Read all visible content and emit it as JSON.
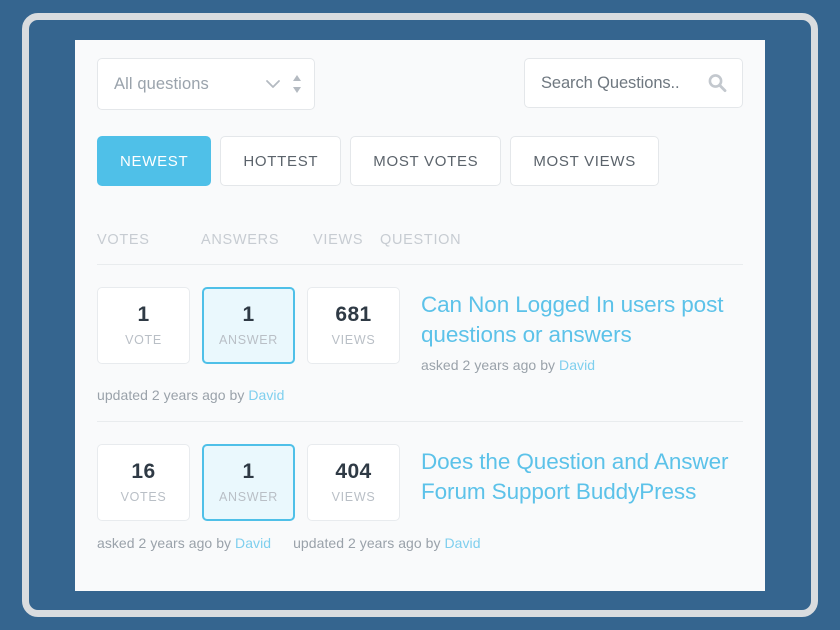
{
  "filter": {
    "selected": "All questions",
    "chevron_icon": "chevron-down-icon",
    "spinner_icon": "sort-spinner-icon"
  },
  "search": {
    "placeholder": "Search Questions..",
    "value": "",
    "icon": "search-icon"
  },
  "tabs": [
    {
      "label": "NEWEST",
      "active": true
    },
    {
      "label": "HOTTEST",
      "active": false
    },
    {
      "label": "MOST VOTES",
      "active": false
    },
    {
      "label": "MOST VIEWS",
      "active": false
    }
  ],
  "columns": {
    "votes": "VOTES",
    "answers": "ANSWERS",
    "views": "VIEWS",
    "question": "QUESTION"
  },
  "questions": [
    {
      "votes_value": "1",
      "votes_label": "VOTE",
      "answers_value": "1",
      "answers_label": "ANSWER",
      "answers_highlight": true,
      "views_value": "681",
      "views_label": "VIEWS",
      "title": "Can Non Logged In users post questions or answers",
      "asked_prefix": "asked 2 years ago by",
      "asked_author": "David",
      "updated_prefix": "updated 2 years ago by",
      "updated_author": "David",
      "foot_show_asked": false,
      "foot_show_updated": true
    },
    {
      "votes_value": "16",
      "votes_label": "VOTES",
      "answers_value": "1",
      "answers_label": "ANSWER",
      "answers_highlight": true,
      "views_value": "404",
      "views_label": "VIEWS",
      "title": "Does the Question and Answer Forum Support BuddyPress",
      "asked_prefix": "asked 2 years ago by",
      "asked_author": "David",
      "updated_prefix": "updated 2 years ago by",
      "updated_author": "David",
      "foot_show_asked": true,
      "foot_show_updated": true
    }
  ],
  "colors": {
    "page_background": "#35658f",
    "frame_border": "#d9dcdf",
    "panel_background": "#f9fafb",
    "accent_blue": "#4fc0e8",
    "link_blue": "#5cc2e9",
    "author_blue": "#7fcfee",
    "stat_number": "#2f3a45",
    "muted_text": "#9aa2aa",
    "header_text": "#c7ccd2"
  }
}
